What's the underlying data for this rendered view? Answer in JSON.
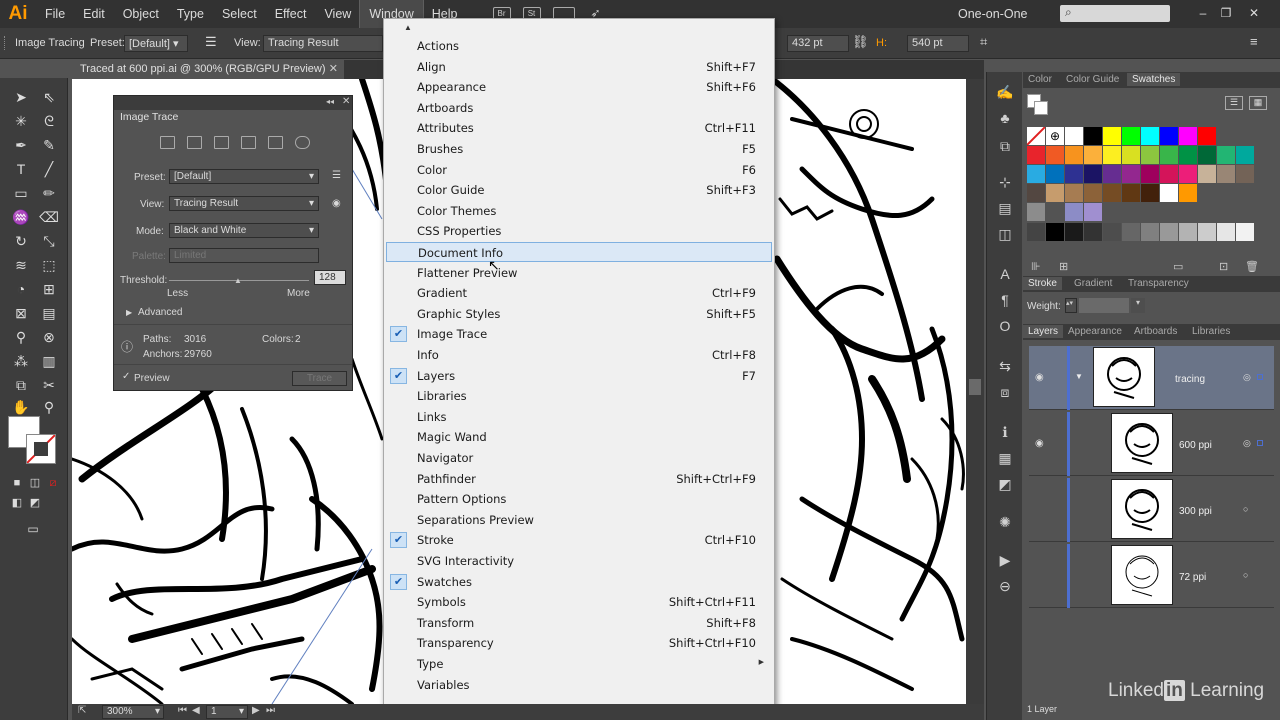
{
  "app": {
    "logo": "Ai",
    "workspace": "One-on-One"
  },
  "menubar": {
    "items": [
      "File",
      "Edit",
      "Object",
      "Type",
      "Select",
      "Effect",
      "View",
      "Window",
      "Help"
    ],
    "icons": [
      "Br",
      "St"
    ]
  },
  "controlbar": {
    "image_tracing_label": "Image Tracing",
    "preset_label": "Preset:",
    "preset_value": "[Default]",
    "view_label": "View:",
    "view_value": "Tracing Result",
    "width_value": "432 pt",
    "height_label": "H:",
    "height_value": "540 pt"
  },
  "document": {
    "tab_title": "Traced at 600 ppi.ai @ 300% (RGB/GPU Preview)"
  },
  "trace_panel": {
    "title": "Image Trace",
    "preset_label": "Preset:",
    "preset_value": "[Default]",
    "view_label": "View:",
    "view_value": "Tracing Result",
    "mode_label": "Mode:",
    "mode_value": "Black and White",
    "palette_label": "Palette:",
    "palette_value": "Limited",
    "threshold_label": "Threshold:",
    "threshold_value": "128",
    "less_label": "Less",
    "more_label": "More",
    "advanced_label": "Advanced",
    "paths_label": "Paths:",
    "paths_value": "3016",
    "colors_label": "Colors:",
    "colors_value": "2",
    "anchors_label": "Anchors:",
    "anchors_value": "29760",
    "preview_label": "Preview",
    "trace_button": "Trace"
  },
  "window_menu": {
    "items": [
      {
        "label": "Actions",
        "shortcut": "",
        "checked": false
      },
      {
        "label": "Align",
        "shortcut": "Shift+F7",
        "checked": false
      },
      {
        "label": "Appearance",
        "shortcut": "Shift+F6",
        "checked": false
      },
      {
        "label": "Artboards",
        "shortcut": "",
        "checked": false
      },
      {
        "label": "Attributes",
        "shortcut": "Ctrl+F11",
        "checked": false
      },
      {
        "label": "Brushes",
        "shortcut": "F5",
        "checked": false
      },
      {
        "label": "Color",
        "shortcut": "F6",
        "checked": false
      },
      {
        "label": "Color Guide",
        "shortcut": "Shift+F3",
        "checked": false
      },
      {
        "label": "Color Themes",
        "shortcut": "",
        "checked": false
      },
      {
        "label": "CSS Properties",
        "shortcut": "",
        "checked": false
      },
      {
        "label": "Document Info",
        "shortcut": "",
        "checked": false,
        "highlighted": true
      },
      {
        "label": "Flattener Preview",
        "shortcut": "",
        "checked": false
      },
      {
        "label": "Gradient",
        "shortcut": "Ctrl+F9",
        "checked": false
      },
      {
        "label": "Graphic Styles",
        "shortcut": "Shift+F5",
        "checked": false
      },
      {
        "label": "Image Trace",
        "shortcut": "",
        "checked": true
      },
      {
        "label": "Info",
        "shortcut": "Ctrl+F8",
        "checked": false
      },
      {
        "label": "Layers",
        "shortcut": "F7",
        "checked": true
      },
      {
        "label": "Libraries",
        "shortcut": "",
        "checked": false
      },
      {
        "label": "Links",
        "shortcut": "",
        "checked": false
      },
      {
        "label": "Magic Wand",
        "shortcut": "",
        "checked": false
      },
      {
        "label": "Navigator",
        "shortcut": "",
        "checked": false
      },
      {
        "label": "Pathfinder",
        "shortcut": "Shift+Ctrl+F9",
        "checked": false
      },
      {
        "label": "Pattern Options",
        "shortcut": "",
        "checked": false
      },
      {
        "label": "Separations Preview",
        "shortcut": "",
        "checked": false
      },
      {
        "label": "Stroke",
        "shortcut": "Ctrl+F10",
        "checked": true
      },
      {
        "label": "SVG Interactivity",
        "shortcut": "",
        "checked": false
      },
      {
        "label": "Swatches",
        "shortcut": "",
        "checked": true
      },
      {
        "label": "Symbols",
        "shortcut": "Shift+Ctrl+F11",
        "checked": false
      },
      {
        "label": "Transform",
        "shortcut": "Shift+F8",
        "checked": false
      },
      {
        "label": "Transparency",
        "shortcut": "Shift+Ctrl+F10",
        "checked": false
      },
      {
        "label": "Type",
        "shortcut": "",
        "checked": false,
        "submenu": true
      },
      {
        "label": "Variables",
        "shortcut": "",
        "checked": false
      }
    ]
  },
  "swatch_panel": {
    "tabs": [
      "Color",
      "Color Guide",
      "Swatches"
    ],
    "colors": [
      "#000000",
      "#ffff00",
      "#00ff00",
      "#00ffff",
      "#0000ff",
      "#ff00ff",
      "#ff0000",
      "#e8242c",
      "#f05a24",
      "#f7931e",
      "#fbb03b",
      "#fcee21",
      "#d9e021",
      "#8cc63f",
      "#39b54a",
      "#009245",
      "#006837",
      "#22b573",
      "#00a99d",
      "#29abe2",
      "#0071bc",
      "#2e3192",
      "#1b1464",
      "#662d91",
      "#93278f",
      "#9e005d",
      "#d4145a",
      "#ed1e79",
      "#c7b299",
      "#998675",
      "#736357",
      "#534741",
      "#c69c6d",
      "#a67c52",
      "#8c6239",
      "#754c24",
      "#603813",
      "#42210b",
      "#ffffff",
      "#ff9900"
    ],
    "grays": [
      "#000000",
      "#1a1a1a",
      "#333333",
      "#4d4d4d",
      "#666666",
      "#808080",
      "#999999",
      "#b3b3b3",
      "#cccccc",
      "#e6e6e6",
      "#f2f2f2"
    ],
    "group_colors": [
      "#8c8cc6",
      "#a08fd0"
    ]
  },
  "stroke_panel": {
    "tabs": [
      "Stroke",
      "Gradient",
      "Transparency"
    ],
    "weight_label": "Weight:"
  },
  "layers_panel": {
    "tabs": [
      "Layers",
      "Appearance",
      "Artboards",
      "Libraries"
    ],
    "layers": [
      {
        "name": "tracing"
      },
      {
        "name": "600 ppi"
      },
      {
        "name": "300 ppi"
      },
      {
        "name": "72 ppi"
      }
    ],
    "footer": "1 Layer"
  },
  "statusbar": {
    "zoom": "300%",
    "artboard": "1"
  },
  "watermark": {
    "text": "Linked",
    "in": "in",
    "suffix": "Learning"
  }
}
